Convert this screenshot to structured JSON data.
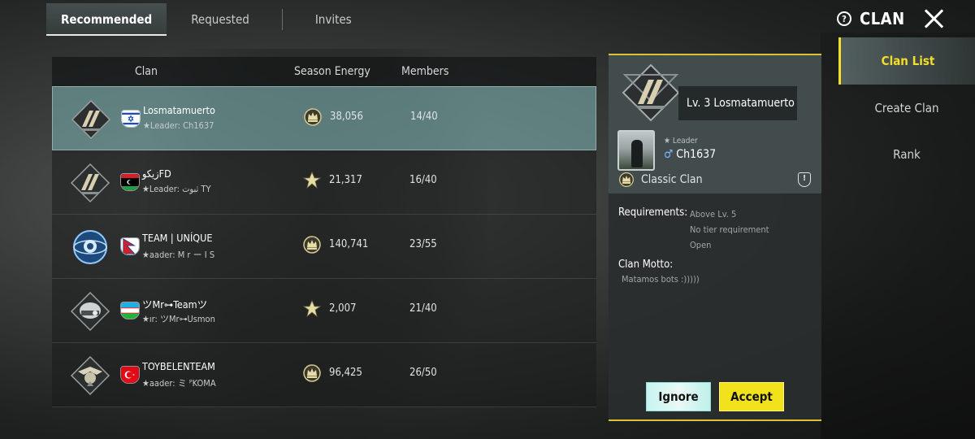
{
  "tabs": [
    {
      "label": "Recommended"
    },
    {
      "label": "Requested"
    },
    {
      "label": "Invites"
    }
  ],
  "header": {
    "title": "CLAN"
  },
  "list": {
    "columns": {
      "clan": "Clan",
      "energy": "Season Energy",
      "members": "Members"
    },
    "rows": [
      {
        "name": "Losmatamuerto",
        "leader": "★Leader: Ch1637",
        "energy": "38,056",
        "members": "14/40",
        "flag": "israel",
        "emblem": "pyramid-emblem"
      },
      {
        "name": "زيكوFD",
        "leader": "★Leader: ثبوت TY",
        "energy": "21,317",
        "members": "16/40",
        "flag": "libya",
        "emblem": "pyramid-emblem"
      },
      {
        "name": "TEAM | UNÍQUE",
        "leader": "★aader: M r ー I S",
        "energy": "140,741",
        "members": "23/55",
        "flag": "nepal",
        "emblem": "winged-globe-emblem"
      },
      {
        "name": "ツMr⊶Teamツ",
        "leader": "★ır: ツMr⊶Usmon",
        "energy": "2,007",
        "members": "21/40",
        "flag": "uzbekistan",
        "emblem": "helmet-emblem"
      },
      {
        "name": "TOYBELENTEAM",
        "leader": "★aader: ミ ᴾKOMA",
        "energy": "96,425",
        "members": "26/50",
        "flag": "turkey",
        "emblem": "eagle-emblem"
      }
    ]
  },
  "detail": {
    "title": "Lv. 3 Losmatamuerto",
    "leader_label": "★ Leader",
    "leader_name": "Ch1637",
    "type": "Classic Clan",
    "requirements_label": "Requirements:",
    "requirements": [
      "Above Lv. 5",
      "No tier requirement",
      "Open"
    ],
    "motto_label": "Clan Motto:",
    "motto": "Matamos bots :)))))",
    "ignore_label": "Ignore",
    "accept_label": "Accept"
  },
  "side_menu": [
    {
      "label": "Clan List"
    },
    {
      "label": "Create Clan"
    },
    {
      "label": "Rank"
    }
  ],
  "colors": {
    "accent": "#f3df2b",
    "selected_row": "#78aaaa",
    "ignore": "#c7f4ef",
    "accept": "#f2e21b"
  }
}
